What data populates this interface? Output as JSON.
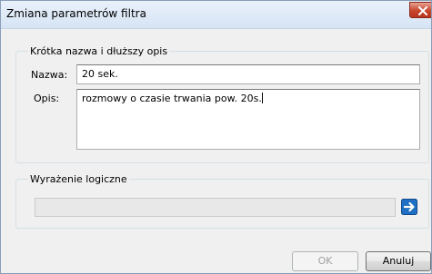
{
  "window": {
    "title": "Zmiana parametrów filtra"
  },
  "short_name_group": {
    "legend": "Krótka nazwa i dłuższy opis",
    "name_label": "Nazwa:",
    "name_value": "20 sek.",
    "description_label": "Opis:",
    "description_value": "rozmowy o czasie trwania pow. 20s."
  },
  "logic_group": {
    "legend": "Wyrażenie logiczne",
    "expression_value": "",
    "edit_icon": "arrow-right-icon"
  },
  "buttons": {
    "ok_label": "OK",
    "cancel_label": "Anuluj"
  },
  "colors": {
    "accent_blue": "#1f6fc4",
    "close_red": "#c7452d"
  }
}
